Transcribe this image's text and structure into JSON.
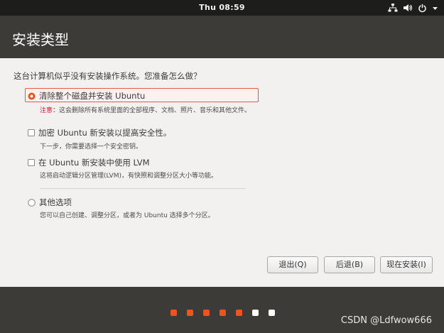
{
  "topbar": {
    "clock": "Thu 08:59"
  },
  "header": {
    "title": "安装类型"
  },
  "content": {
    "question": "这台计算机似乎没有安装操作系统。您准备怎么做？",
    "options": [
      {
        "label": "清除整个磁盘并安装 Ubuntu",
        "selected": true,
        "warn_label": "注意：",
        "desc": "这会删除所有系统里面的全部程序、文档、照片、音乐和其他文件。"
      },
      {
        "label": "加密 Ubuntu 新安装以提高安全性。",
        "checked": false,
        "desc": "下一步，你需要选择一个安全密钥。"
      },
      {
        "label": "在 Ubuntu 新安装中使用 LVM",
        "checked": false,
        "desc": "这将启动逻辑分区管理(LVM)，有快照和调整分区大小等功能。"
      },
      {
        "label": "其他选项",
        "selected": false,
        "desc": "您可以自己创建、调整分区，或者为 Ubuntu 选择多个分区。"
      }
    ]
  },
  "buttons": {
    "quit": "退出(Q)",
    "back": "后退(B)",
    "install": "现在安装(I)"
  },
  "progress": {
    "total_steps": 7,
    "done_steps": 5,
    "done_color": "#e95420",
    "pending_color": "#ffffff"
  },
  "watermark": "CSDN @Ldfwow666"
}
